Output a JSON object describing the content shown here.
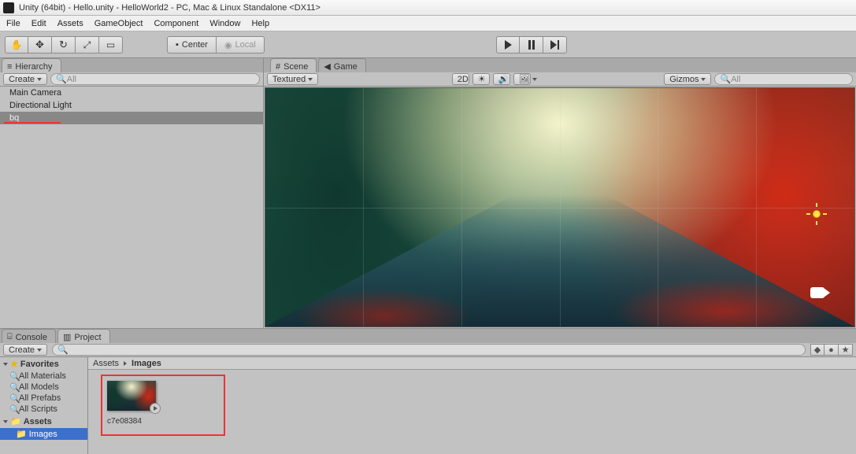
{
  "window": {
    "title": "Unity (64bit) - Hello.unity - HelloWorld2 - PC, Mac & Linux Standalone <DX11>"
  },
  "menu": {
    "items": [
      "File",
      "Edit",
      "Assets",
      "GameObject",
      "Component",
      "Window",
      "Help"
    ]
  },
  "toolbar": {
    "center_label": "Center",
    "local_label": "Local"
  },
  "hierarchy": {
    "tab": "Hierarchy",
    "create": "Create",
    "search_placeholder": "All",
    "items": [
      "Main Camera",
      "Directional Light",
      "bq"
    ]
  },
  "scene": {
    "tabs": {
      "scene": "Scene",
      "game": "Game"
    },
    "shading": "Textured",
    "twod": "2D",
    "gizmos": "Gizmos",
    "search_placeholder": "All"
  },
  "project": {
    "tab_console": "Console",
    "tab_project": "Project",
    "create": "Create",
    "search_placeholder": "",
    "favorites": "Favorites",
    "fav_items": [
      "All Materials",
      "All Models",
      "All Prefabs",
      "All Scripts"
    ],
    "assets": "Assets",
    "assets_items": [
      "Images"
    ],
    "crumb": {
      "root": "Assets",
      "child": "Images"
    },
    "asset_name": "c7e08384"
  }
}
